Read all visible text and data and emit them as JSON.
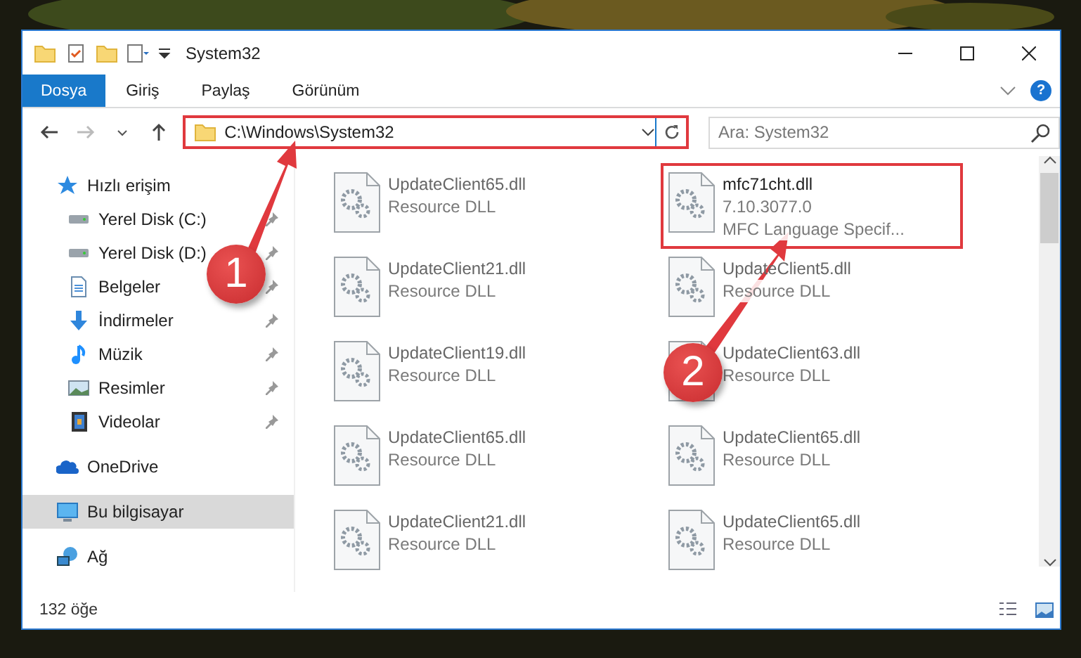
{
  "window": {
    "title": "System32"
  },
  "ribbon_tabs": [
    {
      "label": "Dosya",
      "selected": true
    },
    {
      "label": "Giriş",
      "selected": false
    },
    {
      "label": "Paylaş",
      "selected": false
    },
    {
      "label": "Görünüm",
      "selected": false
    }
  ],
  "help_button": "?",
  "address_bar": {
    "path": "C:\\Windows\\System32",
    "highlighted": true
  },
  "search": {
    "placeholder": "Ara: System32"
  },
  "sidebar": {
    "items": [
      {
        "label": "Hızlı erişim",
        "selected": false,
        "children": [
          {
            "label": "Yerel Disk (C:)",
            "selected": false
          },
          {
            "label": "Yerel Disk (D:)",
            "selected": false
          },
          {
            "label": "Belgeler",
            "selected": false
          },
          {
            "label": "İndirmeler",
            "selected": false
          },
          {
            "label": "Müzik",
            "selected": false
          },
          {
            "label": "Resimler",
            "selected": false
          },
          {
            "label": "Videolar",
            "selected": false
          }
        ]
      },
      {
        "label": "OneDrive",
        "selected": false
      },
      {
        "label": "Bu bilgisayar",
        "selected": true
      },
      {
        "label": "Ağ",
        "selected": false
      }
    ]
  },
  "files": [
    {
      "name": "UpdateClient65.dll",
      "lines": [
        "Resource DLL"
      ],
      "highlighted": false
    },
    {
      "name": "mfc71cht.dll",
      "lines": [
        "7.10.3077.0",
        "MFC Language Specif..."
      ],
      "highlighted": true
    },
    {
      "name": "UpdateClient21.dll",
      "lines": [
        "Resource DLL"
      ],
      "highlighted": false
    },
    {
      "name": "UpdateClient5.dll",
      "lines": [
        "Resource DLL"
      ],
      "highlighted": false
    },
    {
      "name": "UpdateClient19.dll",
      "lines": [
        "Resource DLL"
      ],
      "highlighted": false
    },
    {
      "name": "UpdateClient63.dll",
      "lines": [
        "Resource DLL"
      ],
      "highlighted": false
    },
    {
      "name": "UpdateClient65.dll",
      "lines": [
        "Resource DLL"
      ],
      "highlighted": false
    },
    {
      "name": "UpdateClient65.dll",
      "lines": [
        "Resource DLL"
      ],
      "highlighted": false
    },
    {
      "name": "UpdateClient21.dll",
      "lines": [
        "Resource DLL"
      ],
      "highlighted": false
    },
    {
      "name": "UpdateClient65.dll",
      "lines": [
        "Resource DLL"
      ],
      "highlighted": false
    }
  ],
  "status_bar": {
    "item_count": "132 öğe"
  },
  "annotations": [
    {
      "number": "1"
    },
    {
      "number": "2"
    }
  ]
}
